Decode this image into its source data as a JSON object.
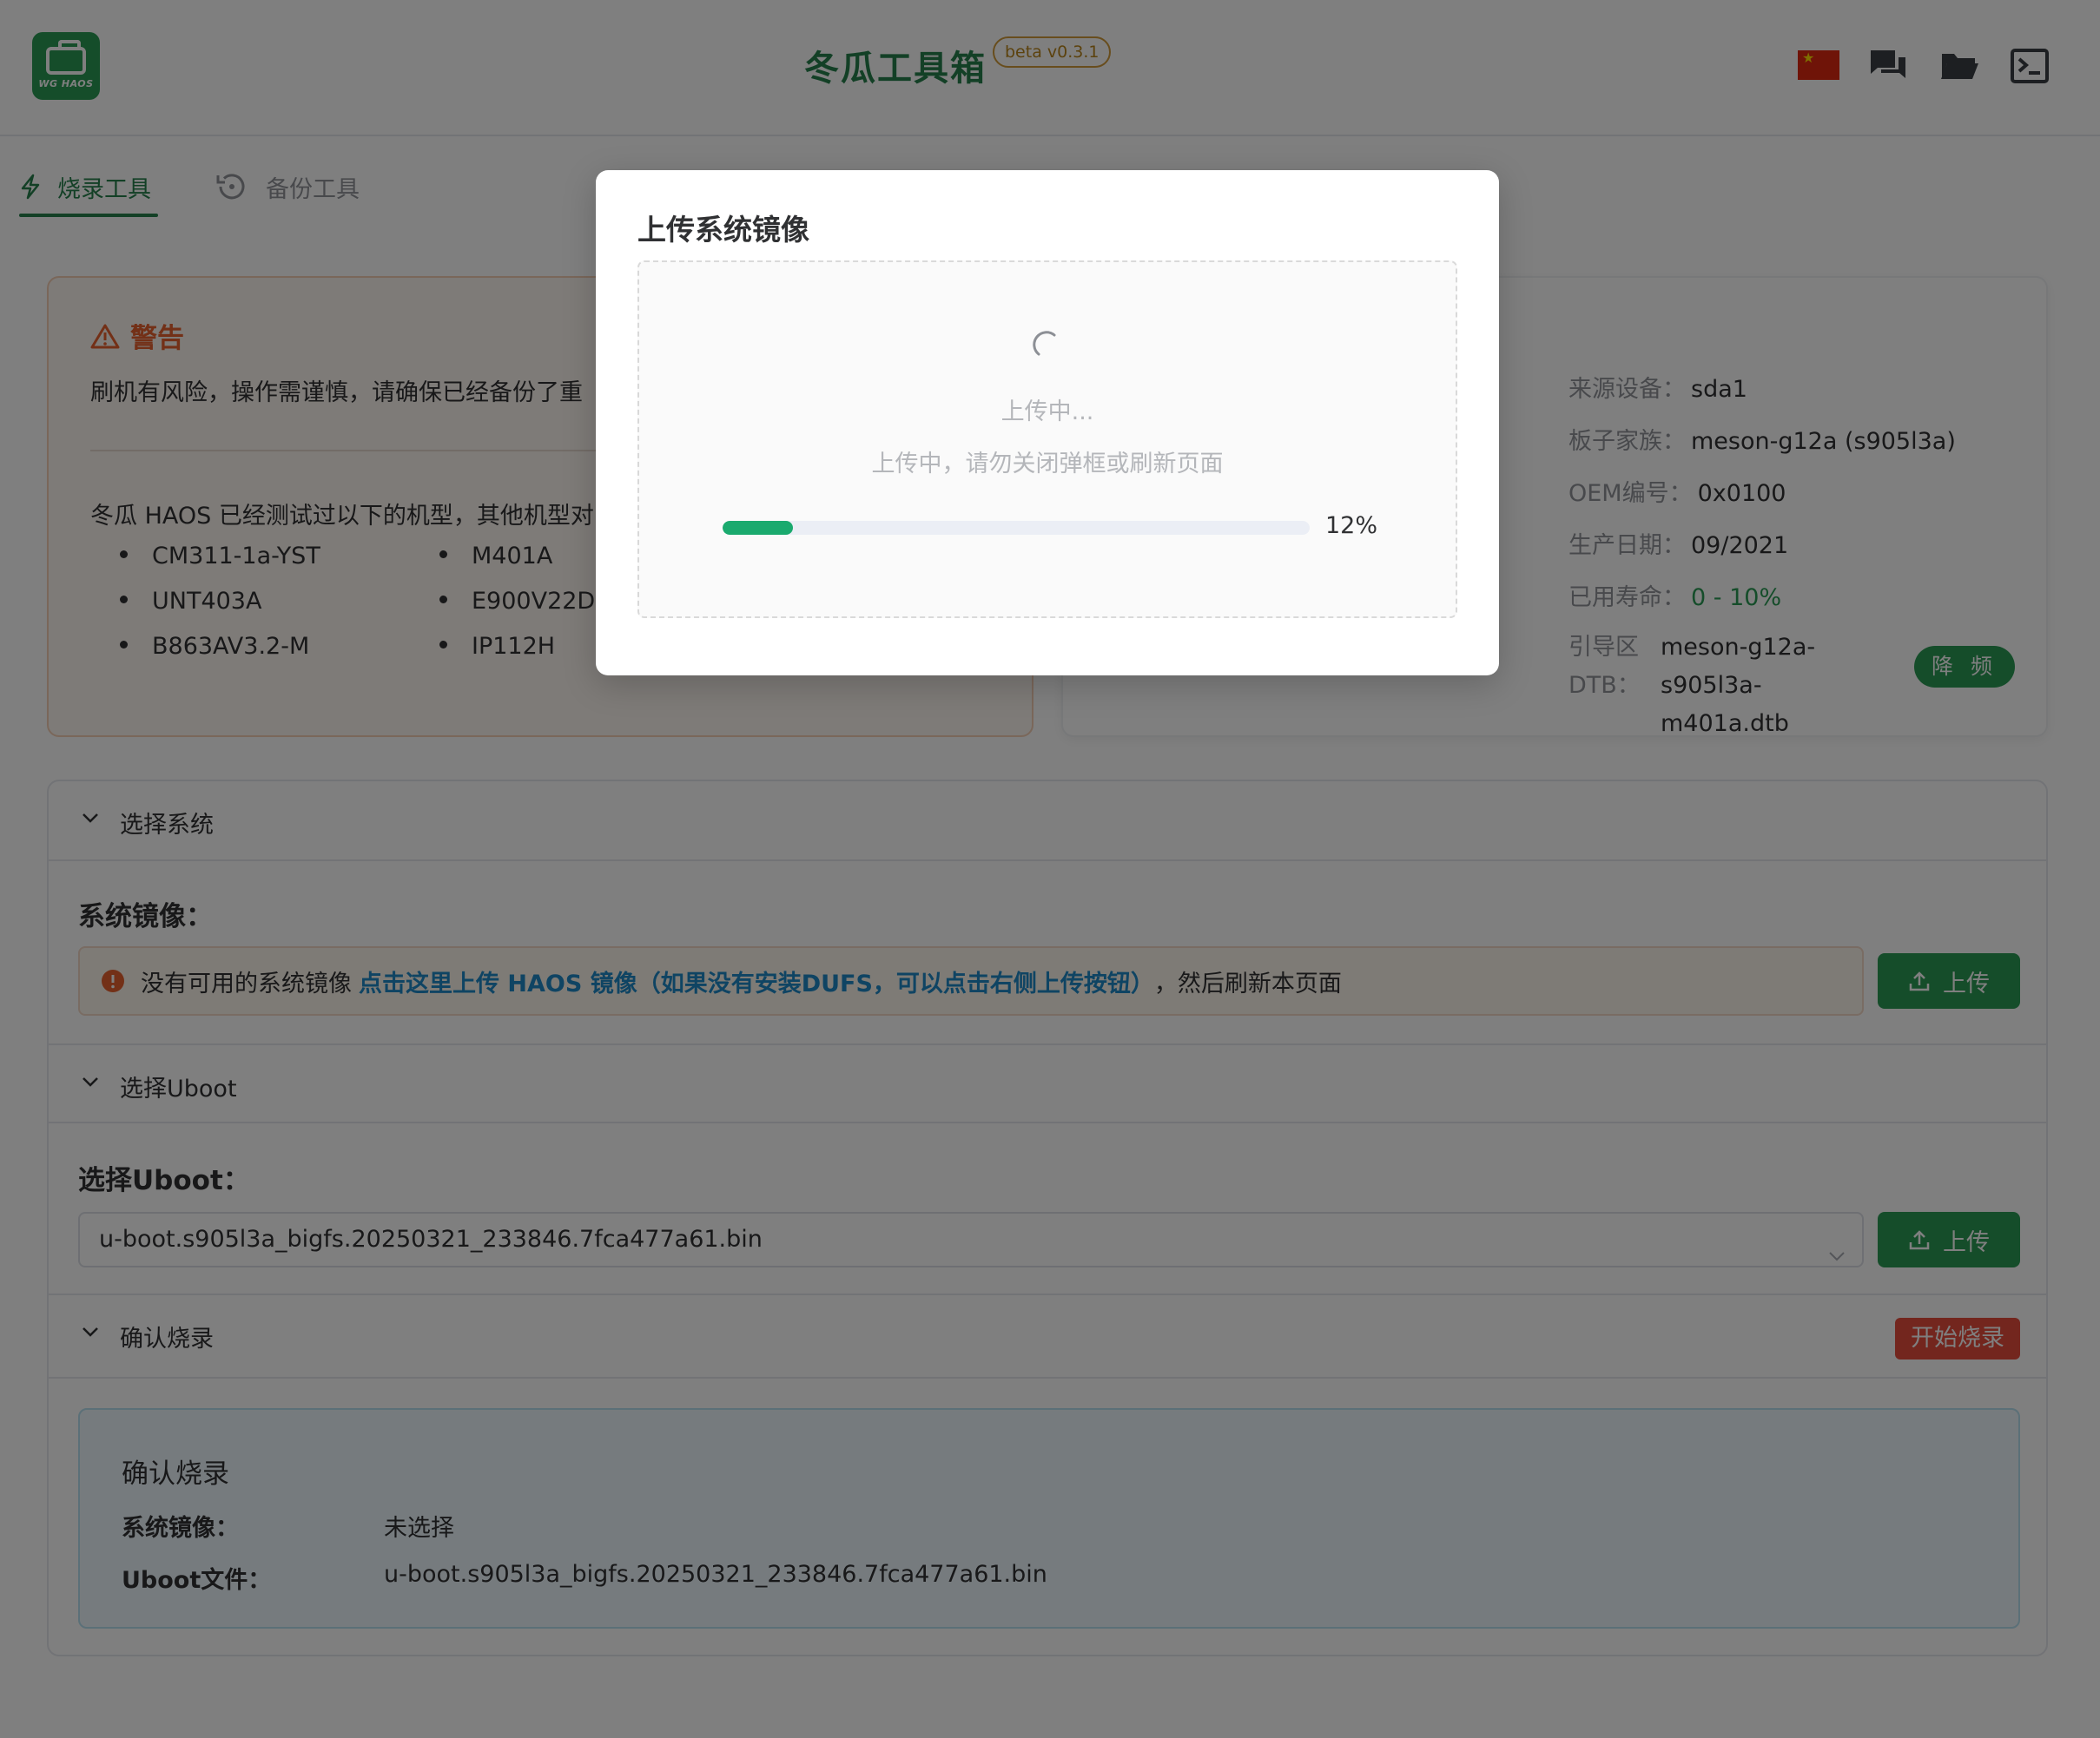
{
  "header": {
    "logo_text": "WG HAOS",
    "title": "冬瓜工具箱",
    "beta": "beta v0.3.1",
    "icons": [
      "cn-flag-icon",
      "chat-icon",
      "folder-icon",
      "terminal-icon"
    ]
  },
  "tabs": [
    {
      "label": "烧录工具",
      "icon": "lightning-icon",
      "active": true
    },
    {
      "label": "备份工具",
      "icon": "history-icon",
      "active": false
    }
  ],
  "warning": {
    "title": "警告",
    "text": "刷机有风险，操作需谨慎，请确保已经备份了重",
    "models_intro": "冬瓜 HAOS 已经测试过以下的机型，其他机型对",
    "models_col1": [
      "CM311-1a-YST",
      "UNT403A",
      "B863AV3.2-M"
    ],
    "models_col2": [
      "M401A",
      "E900V22D",
      "IP112H"
    ]
  },
  "device": {
    "source_label": "来源设备：",
    "source": "sda1",
    "family_label": "板子家族：",
    "family": "meson-g12a (s905l3a)",
    "oem_label": "OEM编号：",
    "oem": "0x0100",
    "date_label": "生产日期：",
    "date": "09/2021",
    "life_label": "已用寿命：",
    "life": "0 - 10%",
    "dtb_label_1": "引导区",
    "dtb_label_2": "DTB：",
    "dtb_value_1": "meson-g12a-",
    "dtb_value_2": "s905l3a-m401a.dtb",
    "freq_button": "降 频"
  },
  "system_section": {
    "header": "选择系统",
    "label": "系统镜像：",
    "alert_text": "没有可用的系统镜像",
    "alert_link": "点击这里上传 HAOS 镜像（如果没有安装DUFS，可以点击右侧上传按钮）",
    "alert_suffix": "，然后刷新本页面",
    "upload_button": "上传"
  },
  "uboot_section": {
    "header": "选择Uboot",
    "label": "选择Uboot：",
    "selected": "u-boot.s905l3a_bigfs.20250321_233846.7fca477a61.bin",
    "upload_button": "上传"
  },
  "confirm_section": {
    "header": "确认烧录",
    "start_button": "开始烧录",
    "box_title": "确认烧录",
    "image_label": "系统镜像：",
    "image_value": "未选择",
    "uboot_label": "Uboot文件：",
    "uboot_value": "u-boot.s905l3a_bigfs.20250321_233846.7fca477a61.bin"
  },
  "modal": {
    "title": "上传系统镜像",
    "status": "上传中...",
    "hint": "上传中，请勿关闭弹框或刷新页面",
    "progress_percent": 12,
    "progress_label": "12%"
  },
  "colors": {
    "brand_green": "#2b9a55",
    "warning_orange": "#e6612e",
    "link_blue": "#1e88c7",
    "danger_red": "#e74c3c",
    "progress_green": "#1aaa6e"
  }
}
